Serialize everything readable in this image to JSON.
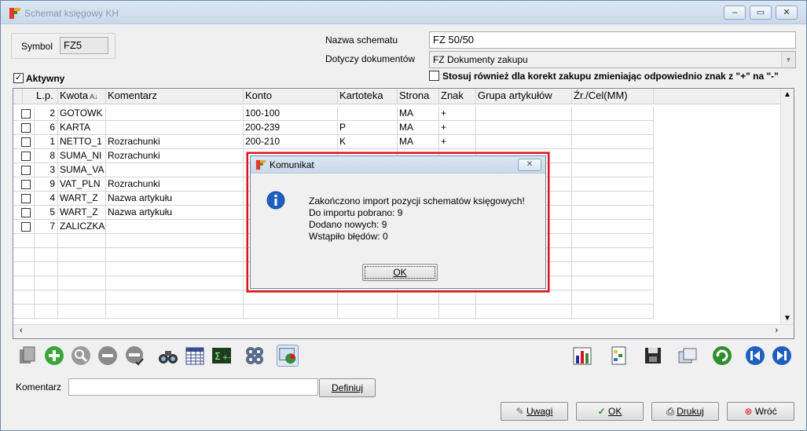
{
  "window": {
    "title": "Schemat księgowy KH"
  },
  "form": {
    "symbol_label": "Symbol",
    "symbol_value": "FZ5",
    "nazwa_label": "Nazwa schematu",
    "nazwa_value": "FZ 50/50",
    "dotyczy_label": "Dotyczy dokumentów",
    "dotyczy_value": "FZ Dokumenty zakupu",
    "aktywny_label": "Aktywny",
    "stosuj_label": "Stosuj również dla korekt zakupu zmieniając odpowiednio znak z \"+\" na \"-\""
  },
  "grid": {
    "headers": [
      "L.p.",
      "Kwota",
      "Komentarz",
      "Konto",
      "Kartoteka",
      "Strona",
      "Znak",
      "Grupa artykułów",
      "Źr./Cel(MM)"
    ],
    "rows": [
      [
        "2",
        "GOTOWK",
        "",
        "100-100",
        "",
        "MA",
        "+"
      ],
      [
        "6",
        "KARTA",
        "",
        "200-239",
        "P",
        "MA",
        "+"
      ],
      [
        "1",
        "NETTO_1",
        "Rozrachunki",
        "200-210",
        "K",
        "MA",
        "+"
      ],
      [
        "8",
        "SUMA_NI",
        "Rozrachunki",
        "",
        "",
        "",
        ""
      ],
      [
        "3",
        "SUMA_VA",
        "",
        "",
        "",
        "",
        ""
      ],
      [
        "9",
        "VAT_PLN",
        "Rozrachunki",
        "",
        "",
        "",
        ""
      ],
      [
        "4",
        "WART_Z",
        "Nazwa artykułu",
        "",
        "",
        "",
        ""
      ],
      [
        "5",
        "WART_Z",
        "Nazwa artykułu",
        "",
        "",
        "",
        ""
      ],
      [
        "7",
        "ZALICZKA",
        "",
        "",
        "",
        "",
        ""
      ]
    ]
  },
  "footer": {
    "komentarz_label": "Komentarz",
    "komentarz_value": "",
    "definiuj": "Definiuj",
    "uwagi": "Uwagi",
    "ok": "OK",
    "drukuj": "Drukuj",
    "wroc": "Wróć"
  },
  "dialog": {
    "title": "Komunikat",
    "line1": "Zakończono import pozycji schematów księgowych!",
    "line2": "Do importu pobrano: 9",
    "line3": "Dodano nowych: 9",
    "line4": "Wstąpiło błędów: 0",
    "ok": "OK"
  },
  "colors": {
    "accent": "#d9151b",
    "info": "#1f5fbf"
  }
}
